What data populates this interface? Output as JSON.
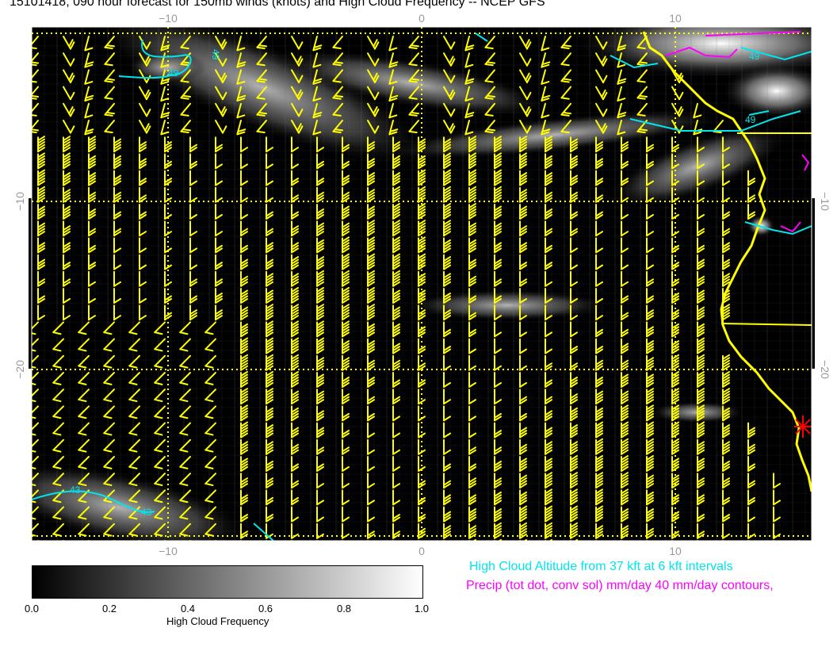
{
  "title": "15101418, 090 hour forecast for 150mb winds (knots) and High Cloud Frequency -- NCEP GFS",
  "map": {
    "top_ticks": [
      "−10",
      "0",
      "10"
    ],
    "bottom_ticks": [
      "−10",
      "0",
      "10"
    ],
    "left_ticks": [
      "−10",
      "−20"
    ],
    "right_ticks": [
      "−10",
      "−20"
    ],
    "contour_labels": [
      "49",
      "49",
      "43",
      "43",
      "49",
      "49"
    ],
    "colors": {
      "background": "#000000",
      "wind_barbs": "#ffff00",
      "coastline": "#ffff00",
      "cloud_altitude_contours": "#00e5ee",
      "precip_contours": "#ff00ff",
      "marker": "#ff0000",
      "grid": "#777777"
    },
    "marker_icon": "red-star-icon"
  },
  "colorbar": {
    "ticks": [
      "0.0",
      "0.2",
      "0.4",
      "0.6",
      "0.8",
      "1.0"
    ],
    "label": "High Cloud Frequency"
  },
  "legend": {
    "cloud_altitude": "High Cloud Altitude from 37 kft at 6 kft intervals",
    "precip": "Precip (tot dot, conv sol) mm/day 40 mm/day contours,"
  }
}
